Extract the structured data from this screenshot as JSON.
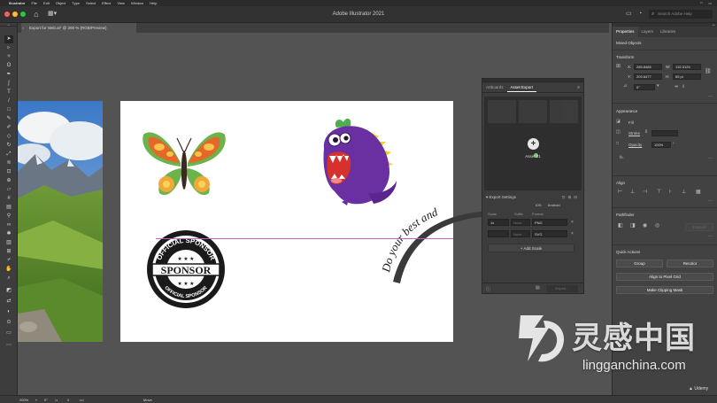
{
  "os_menubar": {
    "apple": "",
    "items": [
      "Illustrator",
      "File",
      "Edit",
      "Object",
      "Type",
      "Select",
      "Effect",
      "View",
      "Window",
      "Help"
    ]
  },
  "app": {
    "title": "Adobe Illustrator 2021",
    "search_placeholder": "Search Adobe Help",
    "traffic_colors": [
      "#ff5f57",
      "#febc2e",
      "#28c840"
    ]
  },
  "document_tab": {
    "label": "Export for Web.ai* @ 200 % (RGB/Preview)",
    "close": "×"
  },
  "artwork": {
    "sponsor_top_text": "OFFICIAL SPONSOR",
    "sponsor_bottom_text": "OFFICIAL SPONSOR",
    "sponsor_center": "SPONSOR",
    "path_text": "Do your best and"
  },
  "asset_export": {
    "tabs": [
      "Artboards",
      "Asset Export"
    ],
    "active_tab": "Asset Export",
    "asset_label": "Asset 21",
    "export_settings": "Export Settings",
    "platforms": [
      "iOS",
      "Android"
    ],
    "columns": [
      "Scale",
      "Suffix",
      "Format"
    ],
    "rows": [
      {
        "scale": "1x",
        "suffix": "None",
        "format": "PNG"
      },
      {
        "scale": "",
        "suffix": "None",
        "format": "SVG"
      }
    ],
    "add_scale": "+ Add Scale",
    "export_button": "Export..."
  },
  "properties": {
    "tabs": [
      "Properties",
      "Layers",
      "Libraries"
    ],
    "selection": "Mixed Objects",
    "transform": {
      "title": "Transform",
      "x_label": "X:",
      "x": "285.8485",
      "y_label": "Y:",
      "y": "203.6477",
      "w_label": "W:",
      "w": "132.3125",
      "h_label": "H:",
      "h": "85 pt",
      "angle": "0°"
    },
    "appearance": {
      "title": "Appearance",
      "fill": "Fill",
      "stroke": "Stroke",
      "opacity": "Opacity",
      "opacity_value": "100%",
      "fx": "fx."
    },
    "align_title": "Align",
    "pathfinder": {
      "title": "Pathfinder",
      "expand": "Expand"
    },
    "quick_actions": {
      "title": "Quick Actions",
      "group": "Group",
      "recolor": "Recolor",
      "align_pixel": "Align to Pixel Grid",
      "clipping_mask": "Make Clipping Mask"
    }
  },
  "statusbar": {
    "zoom": "200%",
    "angle": "0°",
    "artboard": "2",
    "tool": "Move"
  },
  "watermark": {
    "cn": "灵感中国",
    "url": "lingganchina.com"
  },
  "udemy": "Udemy"
}
